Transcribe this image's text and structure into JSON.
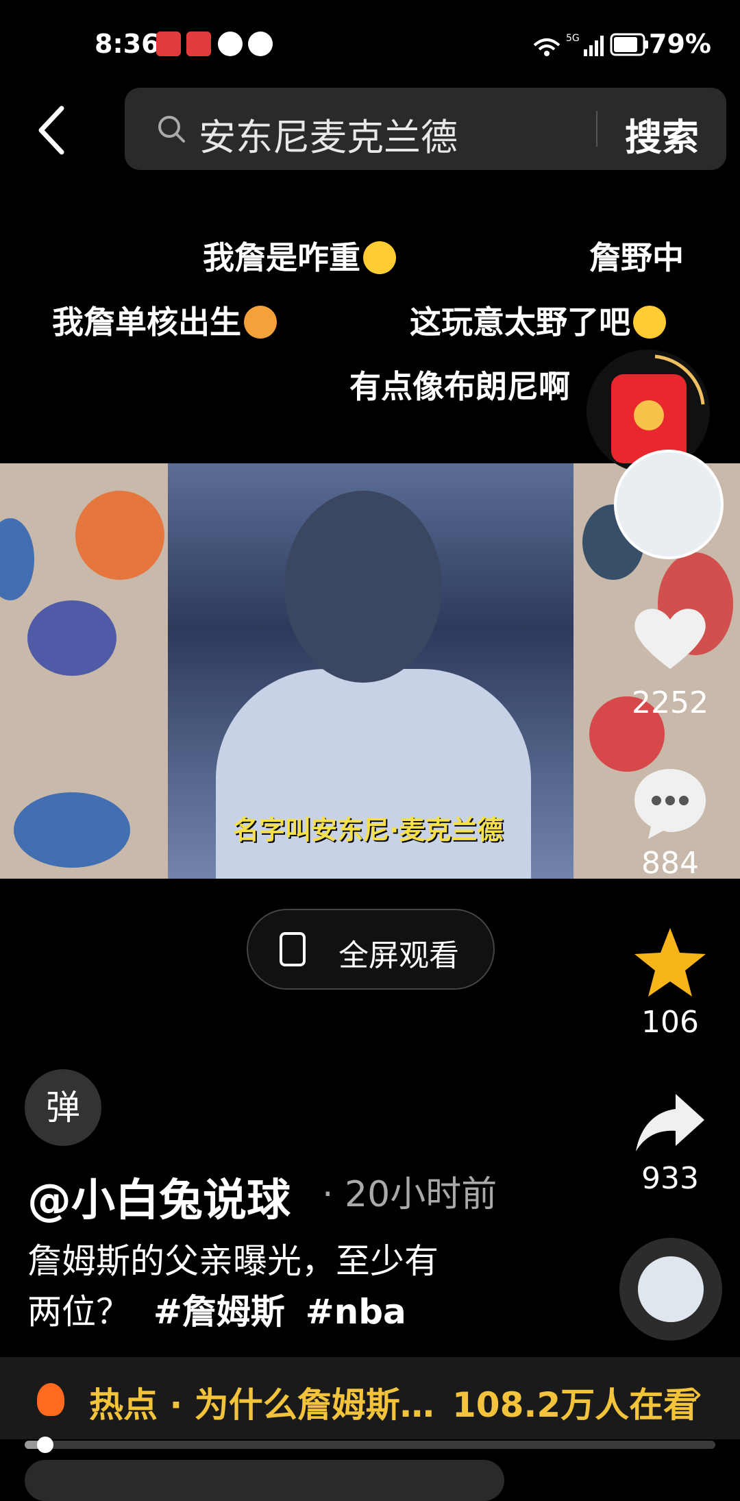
{
  "status_bar": {
    "time": "8:36",
    "network": "5G",
    "battery": "79%"
  },
  "search": {
    "query": "安东尼麦克兰德",
    "button": "搜索"
  },
  "danmaku": [
    {
      "text": "我詹是咋重"
    },
    {
      "text": "詹野中"
    },
    {
      "text": "我詹单核出生"
    },
    {
      "text": "这玩意太野了吧"
    },
    {
      "text": "有点像布朗尼啊"
    }
  ],
  "video": {
    "caption": "名字叫安东尼·麦克兰德",
    "fullscreen_label": "全屏观看"
  },
  "actions": {
    "likes": "2252",
    "comments": "884",
    "favorites": "106",
    "shares": "933"
  },
  "post": {
    "danmu_toggle": "弹",
    "author": "@小白兔说球",
    "time_ago": "· 20小时前",
    "description_line1": "詹姆斯的父亲曝光，至少有",
    "description_line2": "两位？",
    "tag1": "#詹姆斯",
    "tag2": "#nba"
  },
  "hot": {
    "text": "热点 · 为什么詹姆斯…",
    "viewers": "108.2万人在看",
    "arrow": "›"
  },
  "progress": {
    "fraction": 0.03
  }
}
